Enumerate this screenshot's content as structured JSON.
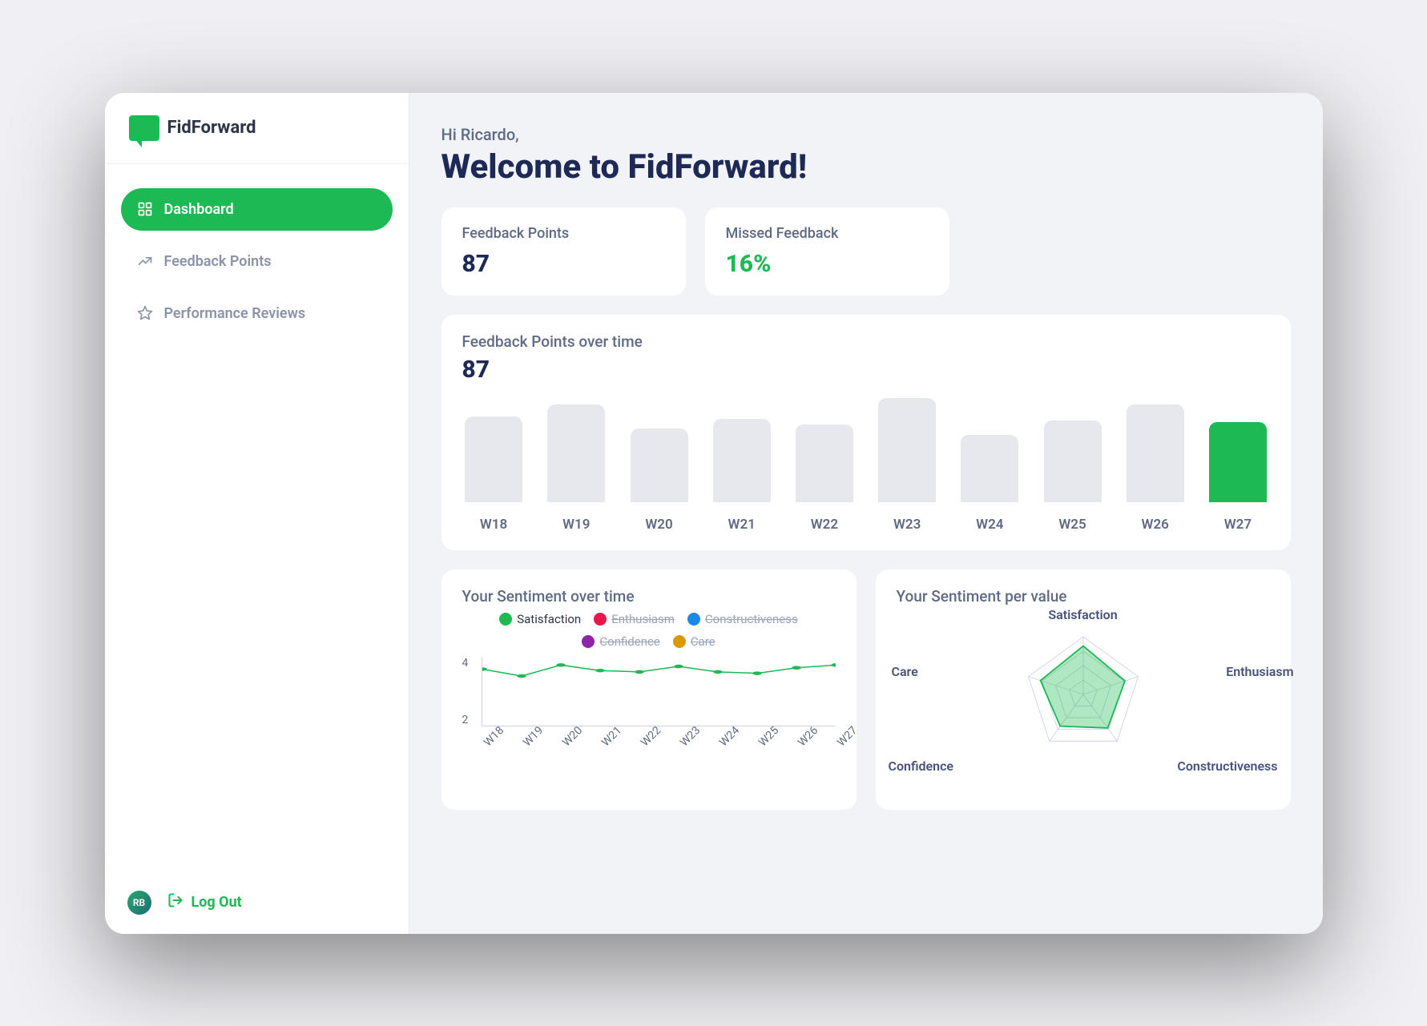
{
  "brand": {
    "name": "FidForward"
  },
  "sidebar": {
    "items": [
      {
        "label": "Dashboard",
        "icon": "dashboard-icon",
        "active": true
      },
      {
        "label": "Feedback Points",
        "icon": "trend-up-icon",
        "active": false
      },
      {
        "label": "Performance Reviews",
        "icon": "star-icon",
        "active": false
      }
    ],
    "avatar_initials": "RB",
    "logout_label": "Log Out"
  },
  "header": {
    "greeting": "Hi Ricardo,",
    "welcome": "Welcome to FidForward!"
  },
  "stats": {
    "feedback_points": {
      "title": "Feedback Points",
      "value": "87"
    },
    "missed_feedback": {
      "title": "Missed Feedback",
      "value": "16%"
    }
  },
  "feedback_over_time": {
    "title": "Feedback Points over time",
    "value": "87"
  },
  "sentiment_over_time": {
    "title": "Your Sentiment over time",
    "legend": [
      {
        "name": "Satisfaction",
        "color": "#1db954",
        "active": true
      },
      {
        "name": "Enthusiasm",
        "color": "#e8174b",
        "active": false
      },
      {
        "name": "Constructiveness",
        "color": "#1e88e5",
        "active": false
      },
      {
        "name": "Confidence",
        "color": "#8e24aa",
        "active": false
      },
      {
        "name": "Care",
        "color": "#d89a00",
        "active": false
      }
    ],
    "y_ticks": [
      "4",
      "2"
    ]
  },
  "sentiment_per_value": {
    "title": "Your Sentiment per value",
    "axes": [
      "Satisfaction",
      "Enthusiasm",
      "Constructiveness",
      "Confidence",
      "Care"
    ]
  },
  "chart_data": [
    {
      "type": "bar",
      "title": "Feedback Points over time",
      "categories": [
        "W18",
        "W19",
        "W20",
        "W21",
        "W22",
        "W23",
        "W24",
        "W25",
        "W26",
        "W27"
      ],
      "values": [
        105,
        120,
        90,
        102,
        95,
        128,
        82,
        100,
        120,
        98
      ],
      "highlight_index": 9,
      "ylabel": "Feedback Points"
    },
    {
      "type": "line",
      "title": "Your Sentiment over time",
      "x": [
        "W18",
        "W19",
        "W20",
        "W21",
        "W22",
        "W23",
        "W24",
        "W25",
        "W26",
        "W27"
      ],
      "series": [
        {
          "name": "Satisfaction",
          "values": [
            4.1,
            3.6,
            4.4,
            4.0,
            3.9,
            4.3,
            3.9,
            3.8,
            4.2,
            4.4
          ],
          "color": "#1db954"
        }
      ],
      "ylim": [
        0,
        5
      ],
      "y_ticks": [
        2,
        4
      ]
    },
    {
      "type": "radar",
      "title": "Your Sentiment per value",
      "axes": [
        "Satisfaction",
        "Enthusiasm",
        "Constructiveness",
        "Confidence",
        "Care"
      ],
      "values": [
        4.2,
        3.8,
        3.6,
        3.4,
        3.9
      ],
      "max": 5
    }
  ]
}
